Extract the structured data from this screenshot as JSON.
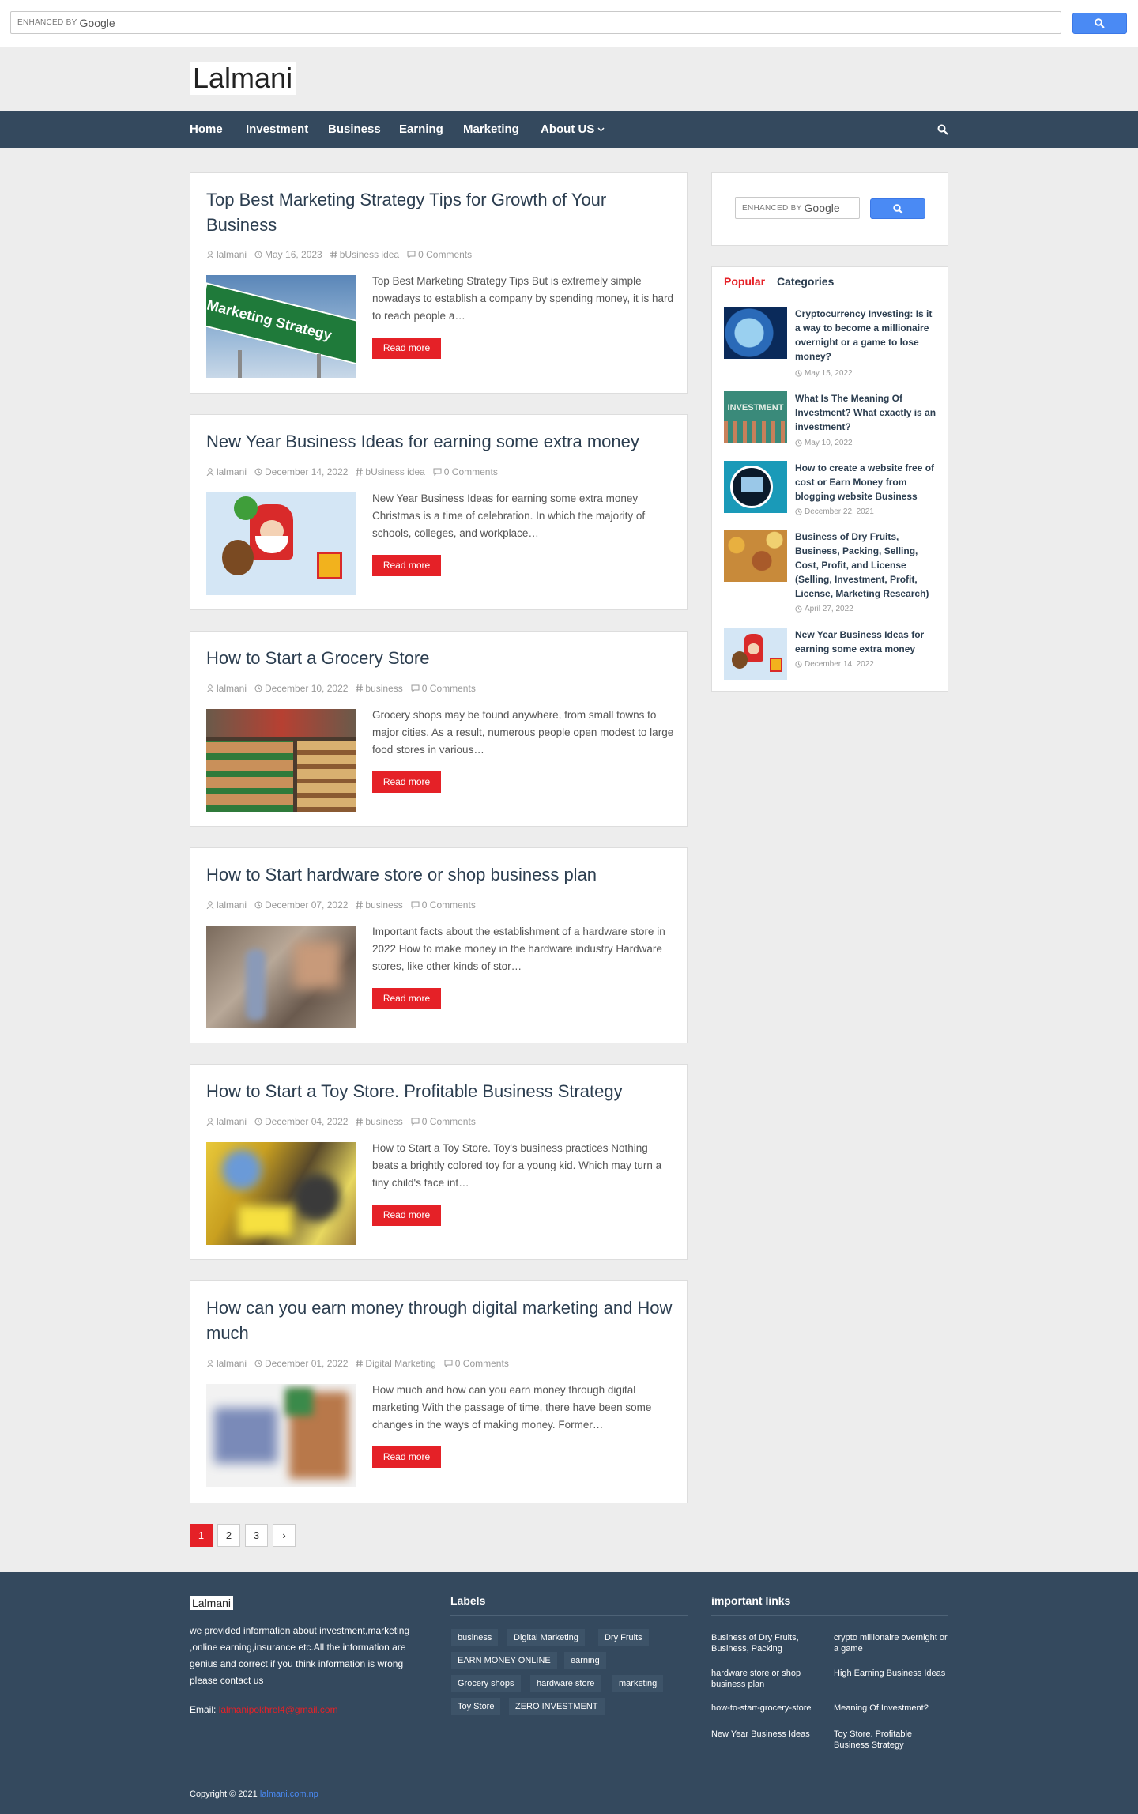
{
  "top_search": {
    "enhanced_by": "ENHANCED BY",
    "google": "Google"
  },
  "site": {
    "logo": "Lalmani"
  },
  "nav": {
    "items": [
      "Home",
      "Investment",
      "Business",
      "Earning",
      "Marketing",
      "About US"
    ]
  },
  "posts": [
    {
      "title": "Top Best Marketing Strategy Tips for Growth of Your Business",
      "author": "lalmani",
      "date": "May 16, 2023",
      "label": "bUsiness idea",
      "comments": "0 Comments",
      "excerpt": "Top Best Marketing Strategy Tips  But is extremely simple nowadays to establish a company by spending money, it is hard to reach people a…",
      "read_more": "Read more",
      "thumb_text": "Marketing Strategy"
    },
    {
      "title": "New Year Business Ideas for earning some extra money",
      "author": "lalmani",
      "date": "December 14, 2022",
      "label": "bUsiness idea",
      "comments": "0 Comments",
      "excerpt": "New Year Business Ideas for earning some extra money Christmas is a time of celebration. In which the majority of schools, colleges, and workplace…",
      "read_more": "Read more"
    },
    {
      "title": "How to Start a Grocery Store",
      "author": "lalmani",
      "date": "December 10, 2022",
      "label": "business",
      "comments": "0 Comments",
      "excerpt": "Grocery shops may be found anywhere, from small towns to major cities. As a result, numerous people open modest to large food stores in various…",
      "read_more": "Read more"
    },
    {
      "title": "How to Start hardware store or shop business plan",
      "author": "lalmani",
      "date": "December 07, 2022",
      "label": "business",
      "comments": "0 Comments",
      "excerpt": "Important facts about the establishment of a hardware store in 2022 How to make money in the hardware industry Hardware stores, like other kinds of stor…",
      "read_more": "Read more"
    },
    {
      "title": "How to Start a Toy Store. Profitable Business Strategy",
      "author": "lalmani",
      "date": "December 04, 2022",
      "label": "business",
      "comments": "0 Comments",
      "excerpt": "How to Start a Toy Store.  Toy's business practices Nothing beats a brightly colored toy for a young kid. Which may turn a tiny child's face int…",
      "read_more": "Read more"
    },
    {
      "title": "How can you earn money through digital marketing and How much",
      "author": "lalmani",
      "date": "December 01, 2022",
      "label": "Digital Marketing",
      "comments": "0 Comments",
      "excerpt": "How much and how can you earn money through digital marketing With the passage of time, there have been some changes in the ways of making money. Former…",
      "read_more": "Read more"
    }
  ],
  "pagination": {
    "pages": [
      "1",
      "2",
      "3"
    ],
    "next": "›",
    "active": "1"
  },
  "sidebar": {
    "search": {
      "enhanced_by": "ENHANCED BY",
      "google": "Google"
    },
    "tabs": [
      "Popular",
      "Categories"
    ],
    "popular": [
      {
        "title": "Cryptocurrency Investing: Is it a way to become a millionaire overnight or a game to lose money?",
        "date": "May 15, 2022"
      },
      {
        "title": "What Is The Meaning Of Investment? What exactly is an investment?",
        "date": "May 10, 2022",
        "thumb_text": "INVESTMENT"
      },
      {
        "title": "How to create a website free of cost or Earn Money from blogging website Business",
        "date": "December 22, 2021"
      },
      {
        "title": "Business of Dry Fruits, Business, Packing, Selling, Cost, Profit, and License (Selling, Investment, Profit, License, Marketing Research)",
        "date": "April 27, 2022"
      },
      {
        "title": "New Year Business Ideas for earning some extra money",
        "date": "December 14, 2022"
      }
    ]
  },
  "footer": {
    "about": {
      "logo": "Lalmani",
      "text": "we provided information about investment,marketing ,online earning,insurance etc.All the information are genius and correct if you think information is wrong please contact us",
      "email_label": "Email: ",
      "email": "lalmanipokhrel4@gmail.com"
    },
    "labels": {
      "title": "Labels",
      "tags": [
        "business",
        "Digital Marketing",
        "Dry Fruits",
        "EARN MONEY ONLINE",
        "earning",
        "Grocery shops",
        "hardware store",
        "marketing",
        "Toy Store",
        "ZERO INVESTMENT"
      ]
    },
    "links": {
      "title": "important links",
      "items": [
        "Business of Dry Fruits, Business, Packing",
        "crypto millionaire overnight or a game",
        "hardware store or shop business plan",
        "High Earning Business Ideas",
        "how-to-start-grocery-store",
        "Meaning Of Investment?",
        "New Year Business Ideas",
        "Toy Store. Profitable Business Strategy"
      ]
    },
    "copyright": "Copyright © 2021 ",
    "site_link": "lalmani.com.np"
  },
  "colors": {
    "accent": "#e52127",
    "nav_bg": "#34495e",
    "search_blue": "#4a8af4",
    "title": "#2c3e50"
  }
}
